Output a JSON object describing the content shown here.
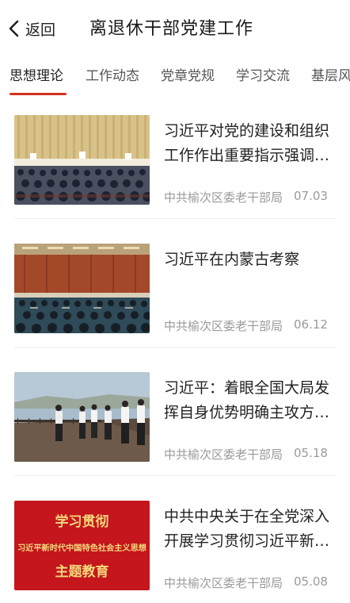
{
  "header": {
    "back_label": "返回",
    "title": "离退休干部党建工作"
  },
  "tabs": [
    {
      "label": "思想理论",
      "active": true
    },
    {
      "label": "工作动态",
      "active": false
    },
    {
      "label": "党章党规",
      "active": false
    },
    {
      "label": "学习交流",
      "active": false
    },
    {
      "label": "基层风",
      "active": false
    }
  ],
  "colors": {
    "accent": "#d6301f",
    "muted_text": "#9a9a9a"
  },
  "articles": [
    {
      "title": "习近平对党的建设和组织工作作出重要指示强调…",
      "source": "中共榆次区委老干部局",
      "date": "07.03",
      "thumb": "meeting-hall-photo"
    },
    {
      "title": "习近平在内蒙古考察",
      "source": "中共榆次区委老干部局",
      "date": "06.12",
      "thumb": "conference-room-photo"
    },
    {
      "title": "习近平：着眼全国大局发挥自身优势明确主攻方…",
      "source": "中共榆次区委老干部局",
      "date": "05.18",
      "thumb": "riverside-inspection-photo"
    },
    {
      "title": "中共中央关于在全党深入开展学习贯彻习近平新…",
      "source": "中共榆次区委老干部局",
      "date": "05.08",
      "thumb": "red-banner-poster",
      "poster_lines": [
        "学习贯彻",
        "习近平新时代中国特色社会主义思想",
        "主题教育"
      ]
    }
  ]
}
